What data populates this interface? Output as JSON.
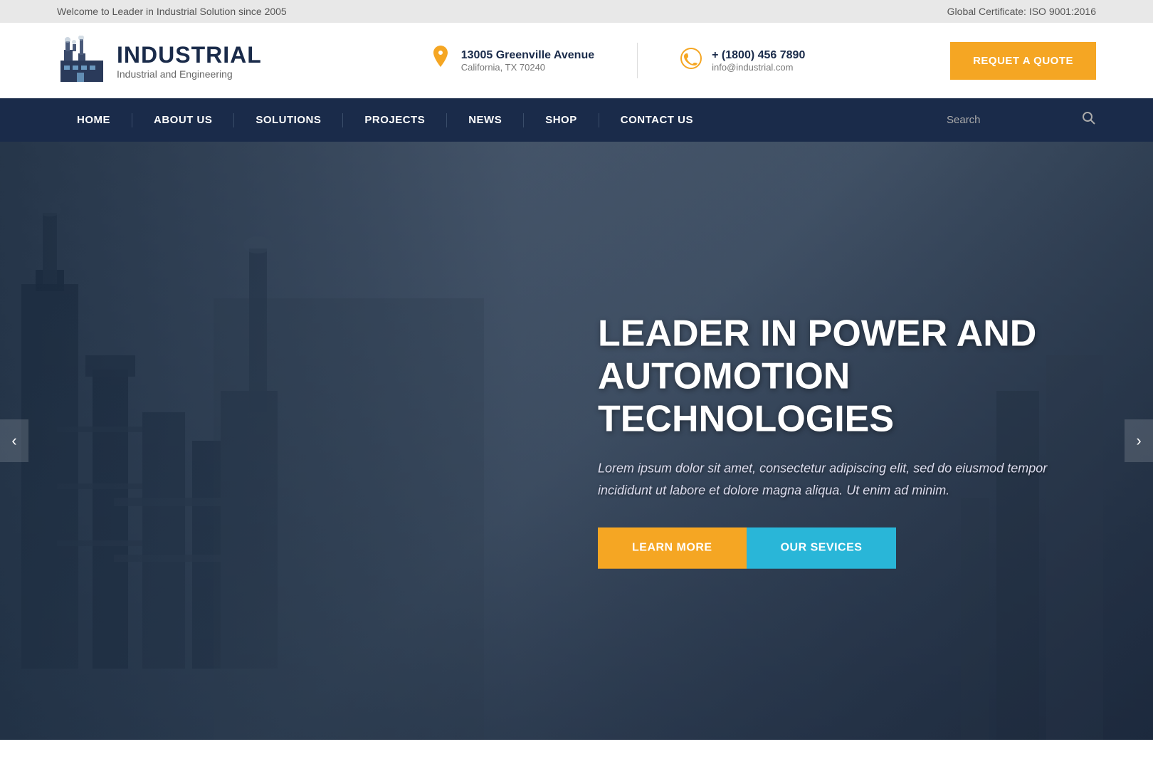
{
  "topbar": {
    "left": "Welcome to Leader in Industrial Solution since 2005",
    "right": "Global Certificate: ISO 9001:2016"
  },
  "header": {
    "logo": {
      "title": "INDUSTRIAL",
      "subtitle": "Industrial and Engineering"
    },
    "address": {
      "line1": "13005 Greenville Avenue",
      "line2": "California, TX 70240"
    },
    "phone": {
      "number": "+ (1800) 456 7890",
      "email": "info@industrial.com"
    },
    "quote_button": "REQUET A QUOTE"
  },
  "navbar": {
    "links": [
      {
        "label": "HOME"
      },
      {
        "label": "ABOUT US"
      },
      {
        "label": "SOLUTIONS"
      },
      {
        "label": "PROJECTS"
      },
      {
        "label": "NEWS"
      },
      {
        "label": "SHOP"
      },
      {
        "label": "CONTACT US"
      }
    ],
    "search_placeholder": "Search"
  },
  "hero": {
    "title": "LEADER IN POWER AND AUTOMOTION TECHNOLOGIES",
    "subtitle": "Lorem ipsum dolor sit amet, consectetur adipiscing elit, sed do eiusmod tempor incididunt ut labore et dolore magna aliqua. Ut enim ad minim.",
    "btn_learn_more": "LEARN MORE",
    "btn_services": "OUR SEVICES"
  },
  "colors": {
    "accent_yellow": "#f5a623",
    "accent_blue": "#29b6d8",
    "nav_bg": "#1a2b4a"
  }
}
